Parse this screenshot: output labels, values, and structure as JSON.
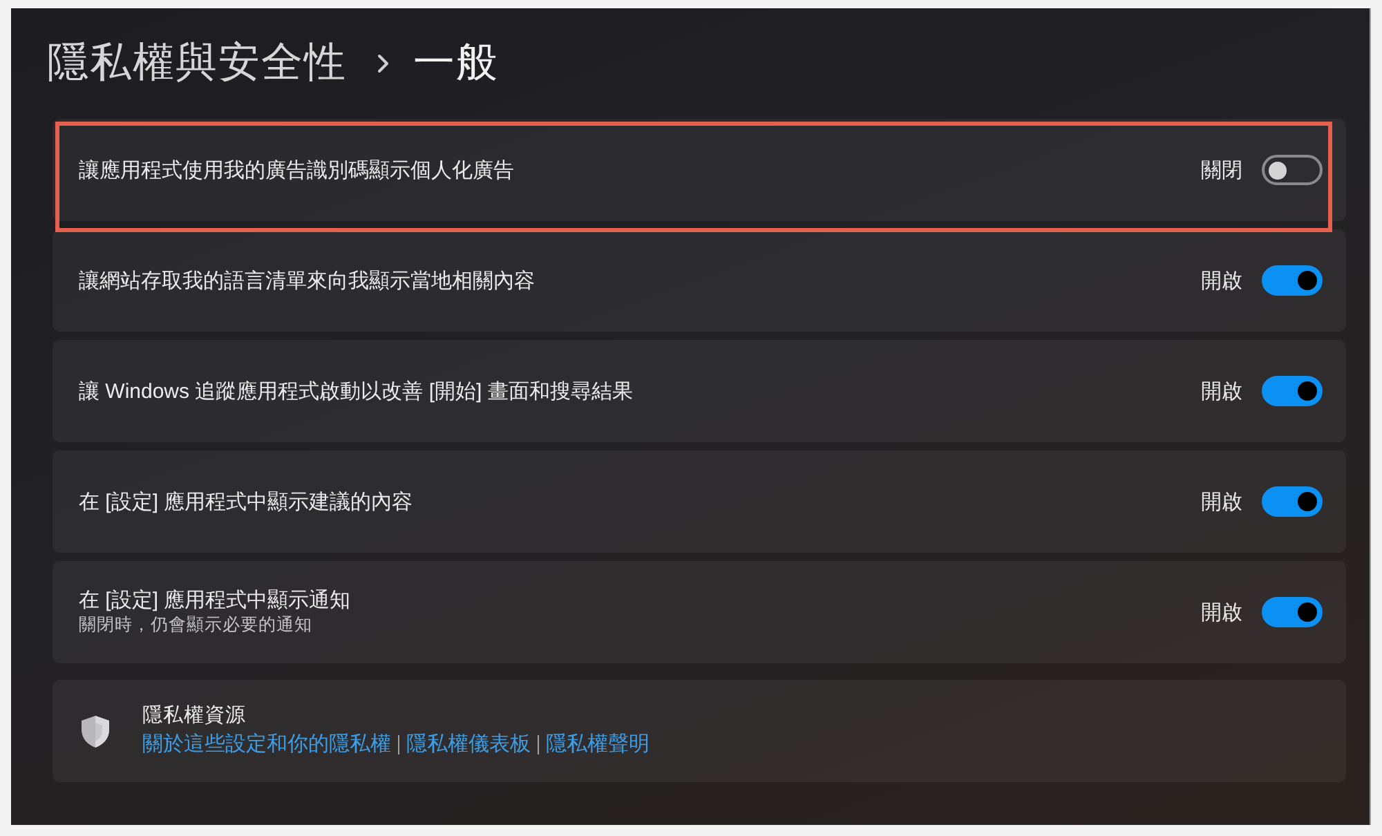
{
  "header": {
    "parent": "隱私權與安全性",
    "title": "一般"
  },
  "settings": [
    {
      "label": "讓應用程式使用我的廣告識別碼顯示個人化廣告",
      "state_text": "關閉",
      "on": false,
      "highlighted": true
    },
    {
      "label": "讓網站存取我的語言清單來向我顯示當地相關內容",
      "state_text": "開啟",
      "on": true,
      "highlighted": false
    },
    {
      "label": "讓 Windows 追蹤應用程式啟動以改善 [開始] 畫面和搜尋結果",
      "state_text": "開啟",
      "on": true,
      "highlighted": false
    },
    {
      "label": "在 [設定] 應用程式中顯示建議的內容",
      "state_text": "開啟",
      "on": true,
      "highlighted": false
    },
    {
      "label": "在 [設定] 應用程式中顯示通知",
      "description": "關閉時，仍會顯示必要的通知",
      "state_text": "開啟",
      "on": true,
      "highlighted": false
    }
  ],
  "resources": {
    "title": "隱私權資源",
    "links": [
      "關於這些設定和你的隱私權",
      "隱私權儀表板",
      "隱私權聲明"
    ]
  }
}
